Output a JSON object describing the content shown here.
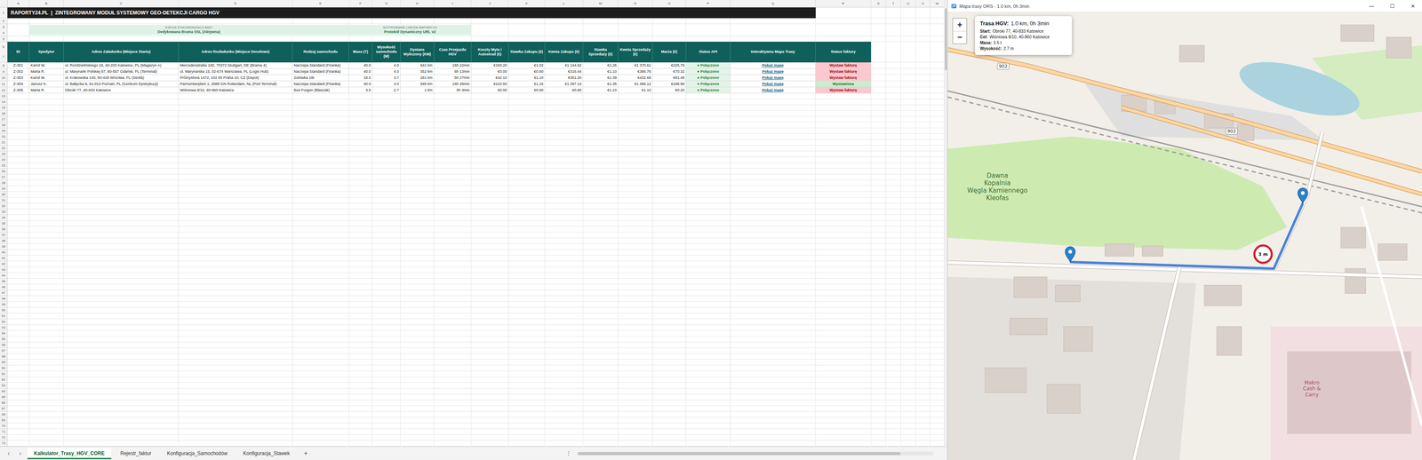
{
  "sheet": {
    "columns": [
      "A",
      "B",
      "C",
      "D",
      "E",
      "F",
      "G",
      "H",
      "I",
      "J",
      "K",
      "L",
      "M",
      "N",
      "O",
      "P",
      "Q",
      "R",
      "S",
      "T",
      "U",
      "V",
      "W"
    ],
    "row_numbers": [
      "1",
      "2",
      "3",
      "4",
      "5",
      "6",
      "7",
      "8",
      "9",
      "10",
      "11",
      "12",
      "13",
      "14",
      "15",
      "16",
      "17",
      "18",
      "19",
      "20",
      "21",
      "22",
      "23",
      "24",
      "25",
      "26",
      "27",
      "28",
      "29",
      "30",
      "31",
      "32",
      "33",
      "34",
      "35",
      "36",
      "37",
      "38",
      "39",
      "40",
      "41",
      "42",
      "43",
      "44",
      "45",
      "46",
      "47",
      "48",
      "49",
      "50",
      "51",
      "52",
      "53",
      "54",
      "55",
      "56",
      "57",
      "58",
      "59",
      "60",
      "61",
      "62",
      "63",
      "64",
      "65",
      "66",
      "67",
      "68",
      "69",
      "70",
      "71",
      "72",
      "73"
    ],
    "title": "RAPORTY24.PL  |  ZINTEGROWANY MODUŁ SYSTEMOWY GEO-DETEKCJI CARGO HGV",
    "status_boxes": [
      {
        "label": "STATUS SYNCHRONIZACJI BAZY",
        "value": "Dedykowana Brama SSL (Aktywna)"
      },
      {
        "label": "SZYFROWANIE LINKÓW MAPOWYCH",
        "value": "Protokół Dynamiczny URL v2"
      }
    ],
    "table": {
      "columns": [
        {
          "label": "ID",
          "kind": "id"
        },
        {
          "label": "Spedytor",
          "kind": "text"
        },
        {
          "label": "Adres Załadunku (Miejsce Startu)",
          "kind": "text"
        },
        {
          "label": "Adres Rozładunku (Miejsce Docelowe)",
          "kind": "text"
        },
        {
          "label": "Rodzaj samochodu",
          "kind": "text"
        },
        {
          "label": "Masa (T)",
          "kind": "number"
        },
        {
          "label": "Wysokość samochodu (M)",
          "kind": "number"
        },
        {
          "label": "Dystans Wyliczony (KM)",
          "kind": "number"
        },
        {
          "label": "Czas Przejazdu HGV",
          "kind": "number"
        },
        {
          "label": "Koszty Myta i Autostrad (€)",
          "kind": "number"
        },
        {
          "label": "Stawka Zakupu (€)",
          "kind": "number"
        },
        {
          "label": "Kwota Zakupu (€)",
          "kind": "number"
        },
        {
          "label": "Stawka Sprzedaży (€)",
          "kind": "number"
        },
        {
          "label": "Kwota Sprzedaży (€)",
          "kind": "number"
        },
        {
          "label": "Marża (€)",
          "kind": "number"
        },
        {
          "label": "Status API",
          "kind": "api"
        },
        {
          "label": "Interaktywna Mapa Trasy",
          "kind": "link"
        },
        {
          "label": "Status faktury",
          "kind": "invoice"
        }
      ],
      "rows": [
        {
          "cells": [
            "Z-301",
            "Kamil W.",
            "ul. Rozdzielińskiego 18, 40-203 Katowice, PL (Magazyn A)",
            "Mercedesstraße 100, 70372 Stuttgart, DE (Brama 4)",
            "Naczepa Standard (Firanka)",
            "40.0",
            "4.0",
            "941 km",
            "16h 22min",
            "€183.20",
            "€1.02",
            "€1 144.62",
            "€1.26",
            "€1 370.61",
            "€225.79",
            "● Połączono",
            "Pokaż mapę",
            "Wystaw fakturę"
          ],
          "invoice_color": "#9c0006",
          "invoice_bg": "#ffc7ce"
        },
        {
          "cells": [
            "Z-302",
            "Marta R.",
            "ul. Marynarki Polskiej 97, 80-557 Gdańsk, PL (Terminal)",
            "ul. Marynarska 15, 02-674 Warszawa, PL (Logis Hub)",
            "Naczepa Standard (Firanka)",
            "40.0",
            "4.0",
            "352 km",
            "6h 13min",
            "€0.00",
            "€0.90",
            "€316.44",
            "€1.10",
            "€386.76",
            "€70.32",
            "● Połączono",
            "Pokaż mapę",
            "Wystaw fakturę"
          ],
          "invoice_color": "#9c0006",
          "invoice_bg": "#ffc7ce"
        },
        {
          "cells": [
            "Z-303",
            "Kamil W.",
            "ul. Krakowska 140, 50-428 Wrocław, PL (Strefa)",
            "Průmyslová 1472, 102 00 Praha 10, CZ (Depot)",
            "Solówka 18t",
            "18.0",
            "3.7",
            "281 km",
            "5h 27min",
            "€42.10",
            "€1.10",
            "€351.20",
            "€1.39",
            "€432.69",
            "€81.49",
            "● Połączono",
            "Pokaż mapę",
            "Wystaw fakturę"
          ],
          "invoice_color": "#9c0006",
          "invoice_bg": "#ffc7ce"
        },
        {
          "cells": [
            "Z-304",
            "Janusz K.",
            "ul. Bałtycka 8, 61-013 Poznań, PL (Centrum Dystrybucji)",
            "Parmentierplein 1, 3088 GN Rotterdam, NL (Port Terminal)",
            "Naczepa Standard (Firanka)",
            "40.0",
            "4.0",
            "945 km",
            "16h 28min",
            "€210.50",
            "€1.15",
            "€1 297.14",
            "€1.35",
            "€1 486.12",
            "€188.98",
            "● Połączono",
            "Pokaż mapę",
            "Wystawiona"
          ],
          "invoice_color": "#1e6b2e",
          "invoice_bg": "#c6efce"
        },
        {
          "cells": [
            "Z-305",
            "Marta R.",
            "Obroki 77, 40-833 Katowice",
            "Wiśniowa 8/10, 40-860 Katowice",
            "Bus Furgon (Blaszak)",
            "3.5",
            "2.7",
            "1 km",
            "0h 3min",
            "€0.00",
            "€0.90",
            "€0.90",
            "€1.10",
            "€1.10",
            "€0.20",
            "● Połączono",
            "Pokaż mapę",
            "Wystaw fakturę"
          ],
          "invoice_color": "#9c0006",
          "invoice_bg": "#ffc7ce"
        }
      ]
    }
  },
  "sheet_tabs": {
    "nav": [
      "‹",
      "›"
    ],
    "tabs": [
      {
        "label": "Kalkulator_Trasy_HGV_CORE",
        "selected": true
      },
      {
        "label": "Rejestr_faktur",
        "selected": false
      },
      {
        "label": "Konfiguracja_Samochodów",
        "selected": false
      },
      {
        "label": "Konfiguracja_Stawek",
        "selected": false
      }
    ],
    "add": "+",
    "more": "⋮"
  },
  "map_window": {
    "title": "Mapa trasy ORS - 1.0 km, 0h 3min",
    "controls": [
      "—",
      "☐",
      "✕"
    ],
    "zoom": [
      "+",
      "−"
    ],
    "popup": {
      "title": "Trasa HGV:",
      "summary": "1.0 km, 0h 3min",
      "lines": [
        {
          "label": "Start:",
          "value": "Obroki 77, 40-833 Katowice"
        },
        {
          "label": "Cel:",
          "value": "Wiśniowa 8/10, 40-860 Katowice"
        },
        {
          "label": "Masa:",
          "value": "3.5 t"
        },
        {
          "label": "Wysokość:",
          "value": "2.7 m"
        }
      ]
    },
    "restriction_sign": "3 m",
    "labels": [
      {
        "lines": [
          "902"
        ]
      },
      {
        "lines": [
          "902"
        ]
      },
      {
        "lines": [
          "Dawna",
          "Kopalnia",
          "Węgla Kamiennego",
          "Kleofas"
        ]
      },
      {
        "lines": [
          "Makro",
          "Cash &",
          "Carry"
        ]
      }
    ]
  }
}
